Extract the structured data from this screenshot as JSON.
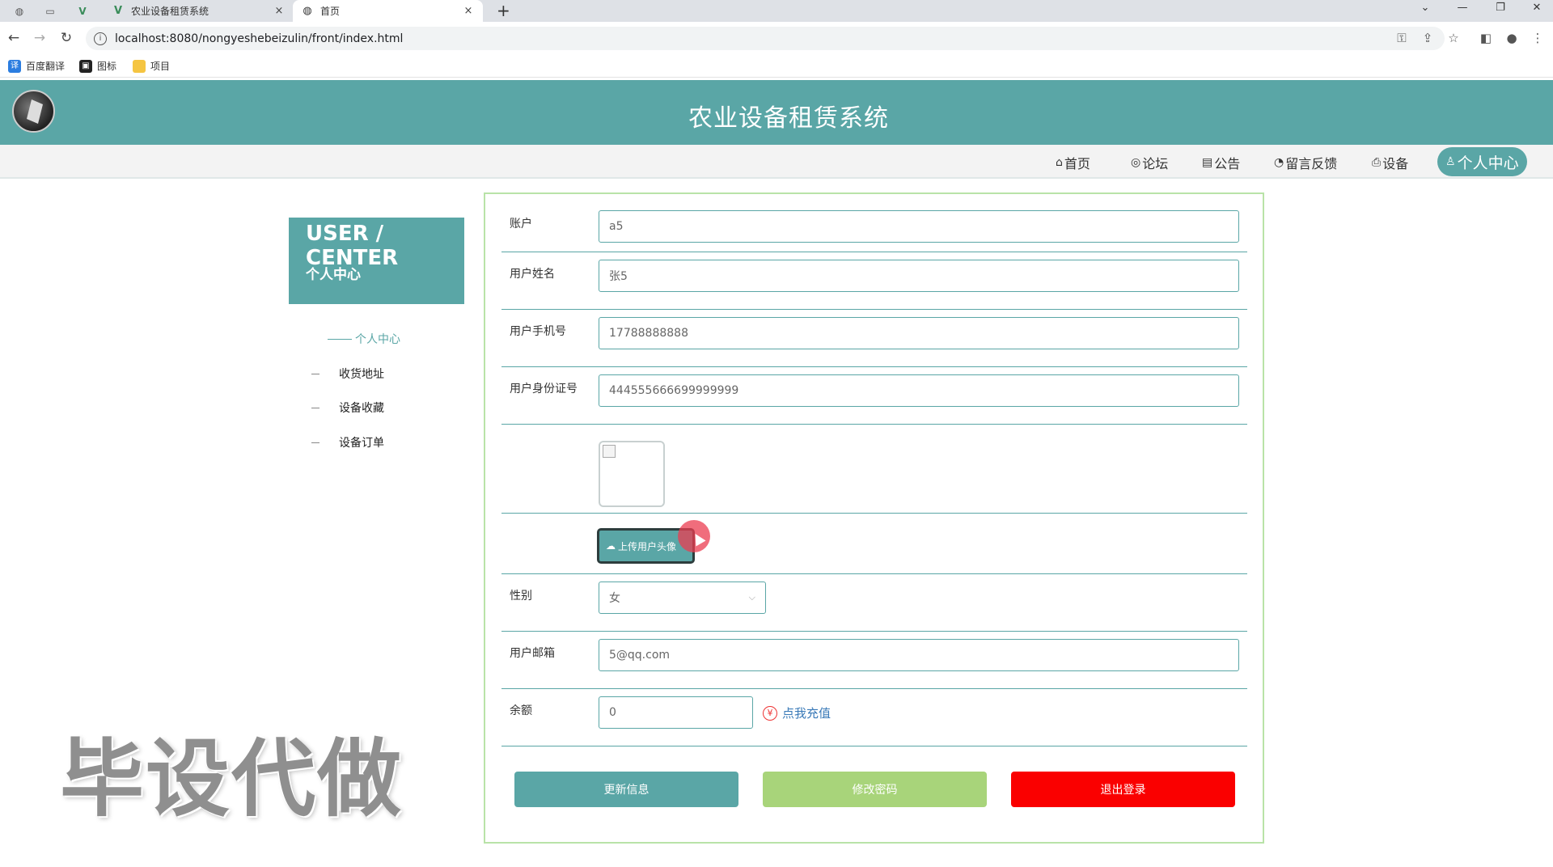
{
  "browser": {
    "tabs": [
      {
        "title": "农业设备租赁系统",
        "close": "×"
      },
      {
        "title": "首页",
        "close": "×"
      }
    ],
    "new_tab": "+",
    "url": "localhost:8080/nongyeshebeizulin/front/index.html",
    "bookmarks": [
      "百度翻译",
      "图标",
      "项目"
    ]
  },
  "site": {
    "title": "农业设备租赁系统",
    "nav": [
      {
        "icon": "⌂",
        "label": "首页"
      },
      {
        "icon": "◎",
        "label": "论坛"
      },
      {
        "icon": "▤",
        "label": "公告"
      },
      {
        "icon": "◔",
        "label": "留言反馈"
      },
      {
        "icon": "⎙",
        "label": "设备"
      },
      {
        "icon": "♙",
        "label": "个人中心"
      }
    ]
  },
  "sidebar": {
    "title_en": "USER / CENTER",
    "title_cn": "个人中心",
    "items": [
      "个人中心",
      "收货地址",
      "设备收藏",
      "设备订单"
    ]
  },
  "watermark": "毕设代做",
  "form": {
    "account": {
      "label": "账户",
      "value": "a5"
    },
    "name": {
      "label": "用户姓名",
      "value": "张5"
    },
    "phone": {
      "label": "用户手机号",
      "value": "17788888888"
    },
    "id_card": {
      "label": "用户身份证号",
      "value": "444555666699999999"
    },
    "upload_label": "上传用户头像",
    "gender": {
      "label": "性别",
      "value": "女"
    },
    "email": {
      "label": "用户邮箱",
      "value": "5@qq.com"
    },
    "balance": {
      "label": "余额",
      "value": "0",
      "recharge": "点我充值"
    }
  },
  "buttons": {
    "update": "更新信息",
    "change_password": "修改密码",
    "logout": "退出登录"
  },
  "colors": {
    "theme": "#5aa6a6",
    "password_button": "#a8d47a",
    "logout_button": "#fa0000",
    "panel_border": "#b9e3a8"
  }
}
